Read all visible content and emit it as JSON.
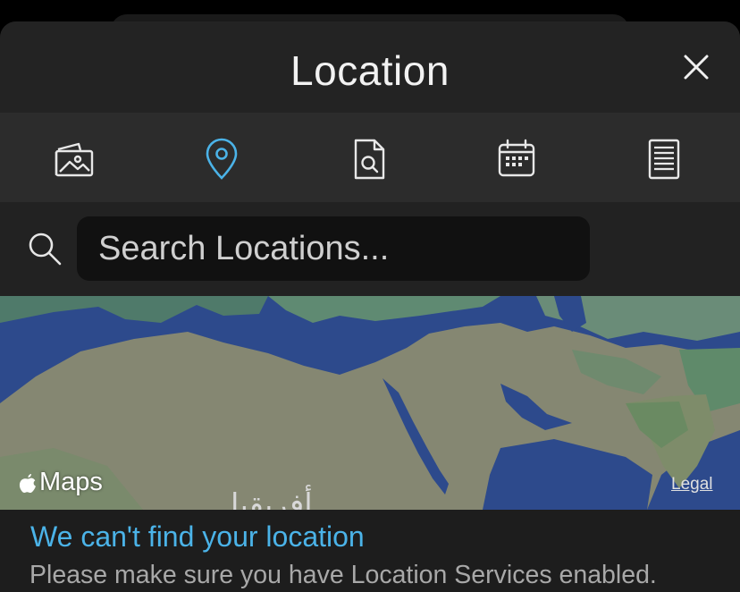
{
  "header": {
    "title": "Location",
    "close_icon": "close-icon"
  },
  "tabs": [
    {
      "name": "photos",
      "icon": "photos-icon",
      "active": false
    },
    {
      "name": "location",
      "icon": "location-pin-icon",
      "active": true
    },
    {
      "name": "document-search",
      "icon": "document-search-icon",
      "active": false
    },
    {
      "name": "calendar",
      "icon": "calendar-icon",
      "active": false
    },
    {
      "name": "notes",
      "icon": "list-document-icon",
      "active": false
    }
  ],
  "search": {
    "placeholder": "Search Locations...",
    "value": ""
  },
  "map": {
    "attribution": "Maps",
    "legal": "Legal",
    "region_label": "أفريقيا"
  },
  "status": {
    "title": "We can't find your location",
    "message": "Please make sure you have Location Services enabled."
  },
  "colors": {
    "accent": "#4bb3e8",
    "background": "#222222",
    "ocean": "#2d4a8c",
    "land": "#858772"
  }
}
